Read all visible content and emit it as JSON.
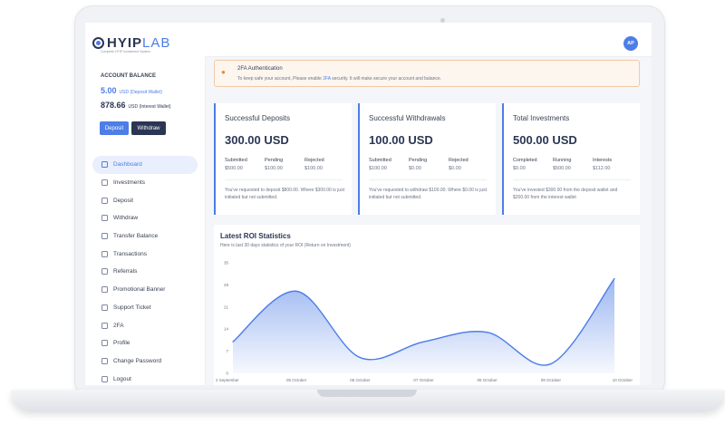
{
  "logo": {
    "brand_a": "HYIP",
    "brand_b": "LAB",
    "tagline": "Complete HYIP Investment System"
  },
  "sidebar": {
    "account_balance_title": "ACCOUNT BALANCE",
    "deposit_wallet": {
      "amount": "5.00",
      "label": "USD (Deposit Wallet)"
    },
    "interest_wallet": {
      "amount": "878.66",
      "label": "USD (Interest Wallet)"
    },
    "deposit_label": "Deposit",
    "withdraw_label": "Withdraw",
    "nav": [
      {
        "label": "Dashboard",
        "icon": "dashboard-icon",
        "active": true
      },
      {
        "label": "Investments",
        "icon": "investments-icon"
      },
      {
        "label": "Deposit",
        "icon": "deposit-icon"
      },
      {
        "label": "Withdraw",
        "icon": "withdraw-icon"
      },
      {
        "label": "Transfer Balance",
        "icon": "transfer-icon"
      },
      {
        "label": "Transactions",
        "icon": "transactions-icon"
      },
      {
        "label": "Referrals",
        "icon": "referrals-icon"
      },
      {
        "label": "Promotional Banner",
        "icon": "banner-icon"
      },
      {
        "label": "Support Ticket",
        "icon": "ticket-icon"
      },
      {
        "label": "2FA",
        "icon": "shield-icon"
      },
      {
        "label": "Profile",
        "icon": "profile-icon"
      },
      {
        "label": "Change Password",
        "icon": "key-icon"
      },
      {
        "label": "Logout",
        "icon": "logout-icon"
      }
    ]
  },
  "header": {
    "avatar_initials": "AP"
  },
  "alert": {
    "title": "2FA Authentication",
    "text_before": "To keep safe your account, Please enable",
    "link": "2FA",
    "text_after": "security. It will make secure your account and balance.",
    "icon": "users-icon",
    "accent": "#e8883a"
  },
  "cards": [
    {
      "title": "Successful Deposits",
      "amount": "300.00 USD",
      "stats": [
        {
          "label": "Submitted",
          "value": "$500.00"
        },
        {
          "label": "Pending",
          "value": "$100.00"
        },
        {
          "label": "Rejected",
          "value": "$100.00"
        }
      ],
      "note": "You've requested to deposit $800.00. Where $300.00 is just initiated but not submitted."
    },
    {
      "title": "Successful Withdrawals",
      "amount": "100.00 USD",
      "stats": [
        {
          "label": "Submitted",
          "value": "$100.00"
        },
        {
          "label": "Pending",
          "value": "$0.00"
        },
        {
          "label": "Rejected",
          "value": "$0.00"
        }
      ],
      "note": "You've requested to withdraw $100.00. Where $0.00 is just initiated but not submitted."
    },
    {
      "title": "Total Investments",
      "amount": "500.00 USD",
      "stats": [
        {
          "label": "Completed",
          "value": "$0.00"
        },
        {
          "label": "Running",
          "value": "$500.00"
        },
        {
          "label": "Interests",
          "value": "$112.00"
        }
      ],
      "note": "You've invested $300.00 from the deposit wallet and $200.00 from the interest wallet"
    }
  ],
  "chart": {
    "title": "Latest ROI Statistics",
    "subtitle": "Here is last 30 days statistics of your ROI (Return on Investment)"
  },
  "chart_data": {
    "type": "area",
    "x_labels": [
      "2 September",
      "05 October",
      "06 October",
      "07 October",
      "08 October",
      "09 October",
      "10 October"
    ],
    "x": [
      0,
      1,
      2,
      3,
      4,
      5,
      6
    ],
    "values": [
      10,
      26,
      5,
      10,
      13,
      3,
      30
    ],
    "yticks": [
      0,
      7,
      14,
      21,
      28,
      35
    ],
    "ylim": [
      0,
      35
    ],
    "grid": false,
    "color": "#4d7de6"
  },
  "colors": {
    "accent": "#4d7de6",
    "dark": "#2b3654"
  }
}
